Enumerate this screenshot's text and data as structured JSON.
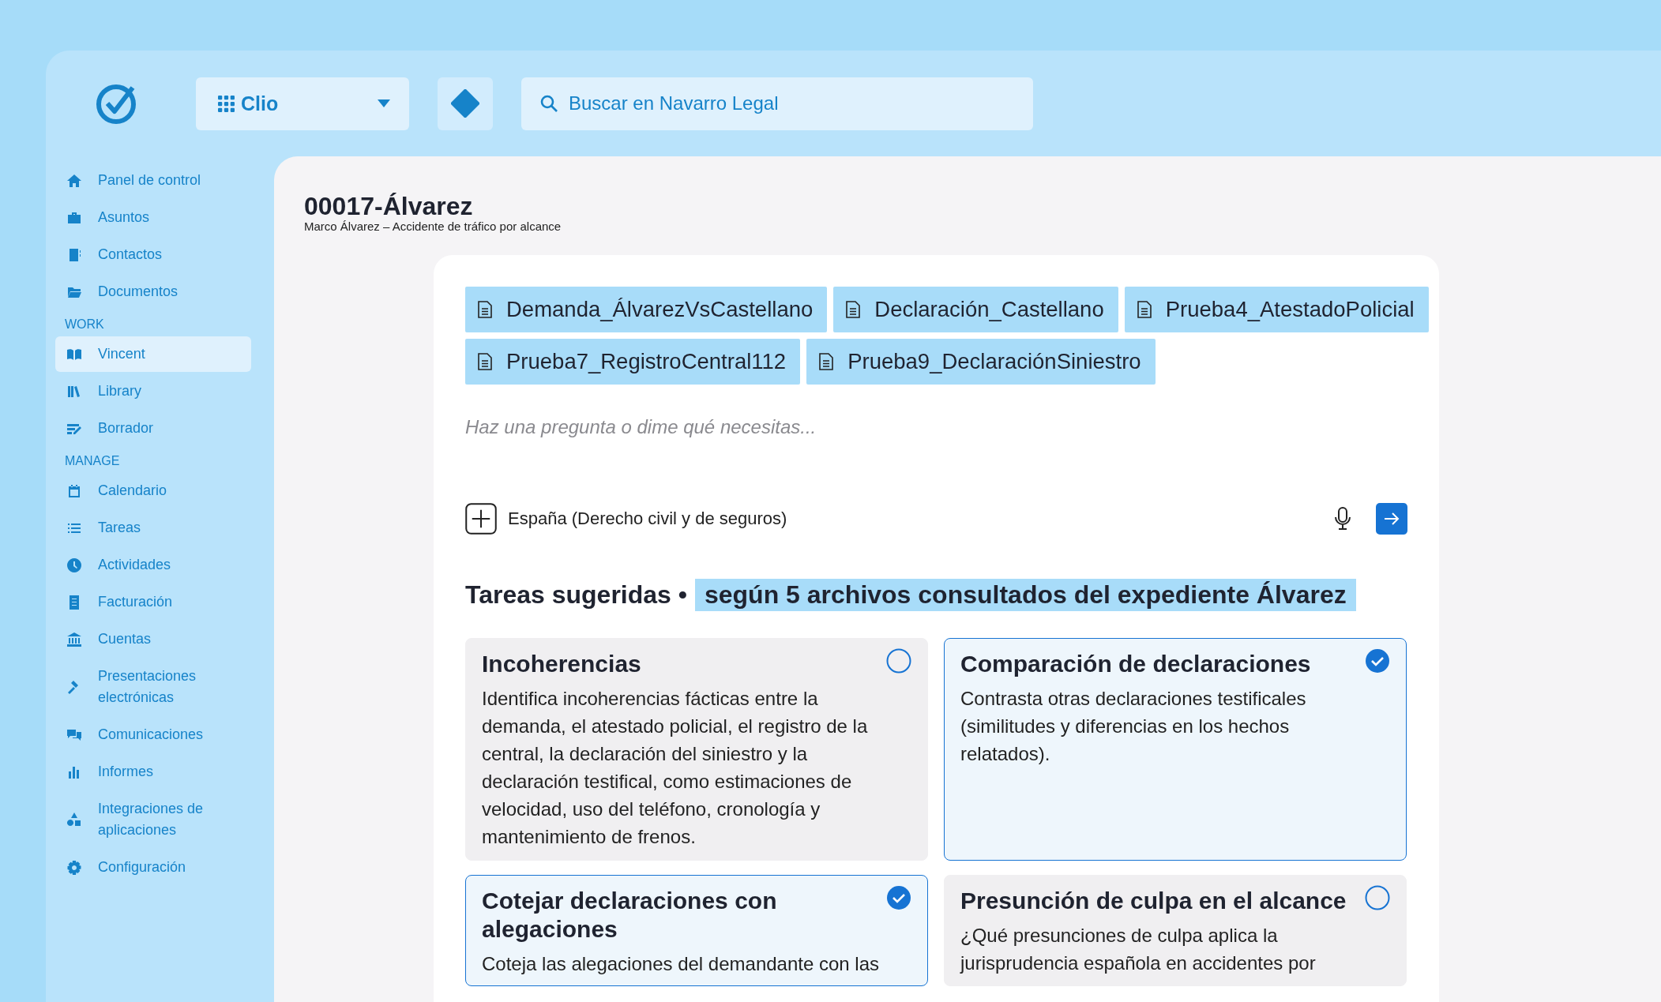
{
  "topbar": {
    "workspace": "Clio",
    "search": {
      "placeholder": "Buscar en Navarro Legal"
    }
  },
  "sidebar": {
    "sections": [
      {
        "items": [
          {
            "label": "Panel de control",
            "selected": false
          },
          {
            "label": "Asuntos",
            "selected": false
          },
          {
            "label": "Contactos",
            "selected": false
          },
          {
            "label": "Documentos",
            "selected": false
          }
        ]
      },
      {
        "heading": "WORK",
        "items": [
          {
            "label": "Vincent",
            "selected": true
          },
          {
            "label": "Library",
            "selected": false
          },
          {
            "label": "Borrador",
            "selected": false
          }
        ]
      },
      {
        "heading": "MANAGE",
        "items": [
          {
            "label": "Calendario",
            "selected": false
          },
          {
            "label": "Tareas",
            "selected": false
          },
          {
            "label": "Actividades",
            "selected": false
          },
          {
            "label": "Facturación",
            "selected": false
          },
          {
            "label": "Cuentas",
            "selected": false
          },
          {
            "label": "Presentaciones electrónicas",
            "selected": false
          },
          {
            "label": "Comunicaciones",
            "selected": false
          },
          {
            "label": "Informes",
            "selected": false
          },
          {
            "label": "Integraciones de aplicaciones",
            "selected": false
          },
          {
            "label": "Configuración",
            "selected": false
          }
        ]
      }
    ]
  },
  "matter": {
    "title": "00017-Álvarez",
    "subtitle": "Marco Álvarez – Accidente de tráfico por alcance"
  },
  "chat": {
    "attachments": [
      "Demanda_ÁlvarezVsCastellano",
      "Declaración_Castellano",
      "Prueba4_AtestadoPolicial",
      "Prueba7_RegistroCentral112",
      "Prueba9_DeclaraciónSiniestro"
    ],
    "placeholder": "Haz una pregunta o dime qué necesitas...",
    "jurisdiction": "España (Derecho civil y de seguros)"
  },
  "suggestions": {
    "heading": "Tareas sugeridas •",
    "source": "según 5 archivos consultados del expediente Álvarez",
    "tasks": [
      {
        "title": "Incoherencias",
        "description": "Identifica incoherencias fácticas entre la demanda, el atestado policial, el registro de la central, la declaración del siniestro y la declaración testifical, como estimaciones de velocidad, uso del teléfono, cronología y mantenimiento de frenos.",
        "checked": false
      },
      {
        "title": "Comparación de declaraciones",
        "description": "Contrasta otras declaraciones testificales (similitudes y diferencias en los hechos relatados).",
        "checked": true
      },
      {
        "title": "Cotejar declaraciones con alegaciones",
        "description": "Coteja las alegaciones del demandante con las",
        "checked": true
      },
      {
        "title": "Presunción de culpa en el alcance",
        "description": "¿Qué presunciones de culpa aplica la jurisprudencia española en accidentes por",
        "checked": false
      }
    ]
  }
}
